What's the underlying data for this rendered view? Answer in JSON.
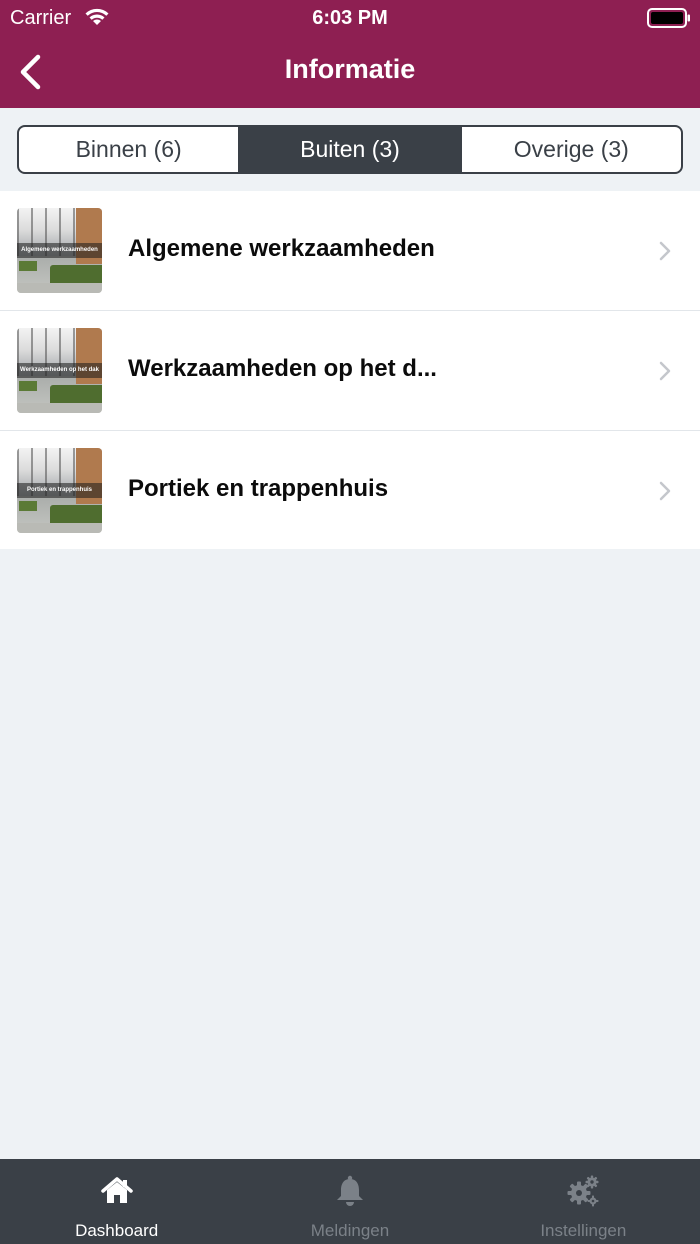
{
  "status_bar": {
    "carrier": "Carrier",
    "time": "6:03 PM"
  },
  "nav": {
    "title": "Informatie",
    "back_icon": "chevron-left-icon"
  },
  "segments": [
    {
      "label": "Binnen (6)",
      "active": false
    },
    {
      "label": "Buiten (3)",
      "active": true
    },
    {
      "label": "Overige (3)",
      "active": false
    }
  ],
  "items": [
    {
      "title": "Algemene werkzaamheden",
      "thumb_caption": "Algemene werkzaamheden"
    },
    {
      "title": "Werkzaamheden op het d...",
      "thumb_caption": "Werkzaamheden op het dak"
    },
    {
      "title": "Portiek en trappenhuis",
      "thumb_caption": "Portiek en trappenhuis"
    }
  ],
  "tab_bar": {
    "tabs": [
      {
        "label": "Dashboard",
        "icon": "home-icon",
        "active": true
      },
      {
        "label": "Meldingen",
        "icon": "bell-icon",
        "active": false
      },
      {
        "label": "Instellingen",
        "icon": "gears-icon",
        "active": false
      }
    ]
  },
  "colors": {
    "brand": "#8e1f52",
    "dark": "#3a4047",
    "background": "#eef2f5"
  }
}
